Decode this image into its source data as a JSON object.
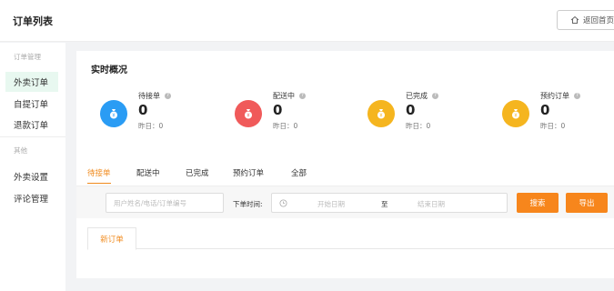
{
  "header": {
    "title": "订单列表",
    "back_label": "返回首页"
  },
  "sidebar": {
    "groups": [
      {
        "title": "订单管理",
        "items": [
          {
            "label": "外卖订单",
            "active": true
          },
          {
            "label": "自提订单"
          },
          {
            "label": "退款订单"
          }
        ]
      },
      {
        "title": "其他",
        "items": [
          {
            "label": "外卖设置"
          },
          {
            "label": "评论管理"
          }
        ]
      }
    ]
  },
  "overview": {
    "title": "实时概况",
    "stats": [
      {
        "label": "待接单",
        "value": "0",
        "yesterday": "昨日：0",
        "color": "#2a9cf4",
        "icon": "money-bag-icon"
      },
      {
        "label": "配送中",
        "value": "0",
        "yesterday": "昨日：0",
        "color": "#f05a5a",
        "icon": "money-bag-icon"
      },
      {
        "label": "已完成",
        "value": "0",
        "yesterday": "昨日：0",
        "color": "#f5b51f",
        "icon": "money-bag-icon"
      },
      {
        "label": "预约订单",
        "value": "0",
        "yesterday": "昨日：0",
        "color": "#f5b51f",
        "icon": "money-bag-icon"
      }
    ]
  },
  "tabs": [
    {
      "label": "待接单",
      "active": true
    },
    {
      "label": "配送中"
    },
    {
      "label": "已完成"
    },
    {
      "label": "预约订单"
    },
    {
      "label": "全部"
    }
  ],
  "filter": {
    "search_placeholder": "用户姓名/电话/订单编号",
    "time_label": "下单时间:",
    "start_placeholder": "开始日期",
    "range_sep": "至",
    "end_placeholder": "结束日期",
    "search_button": "搜索",
    "export_button": "导出"
  },
  "subtabs": [
    {
      "label": "新订单"
    }
  ],
  "colors": {
    "accent": "#f7861c",
    "active_bg": "#e8f8f0"
  }
}
